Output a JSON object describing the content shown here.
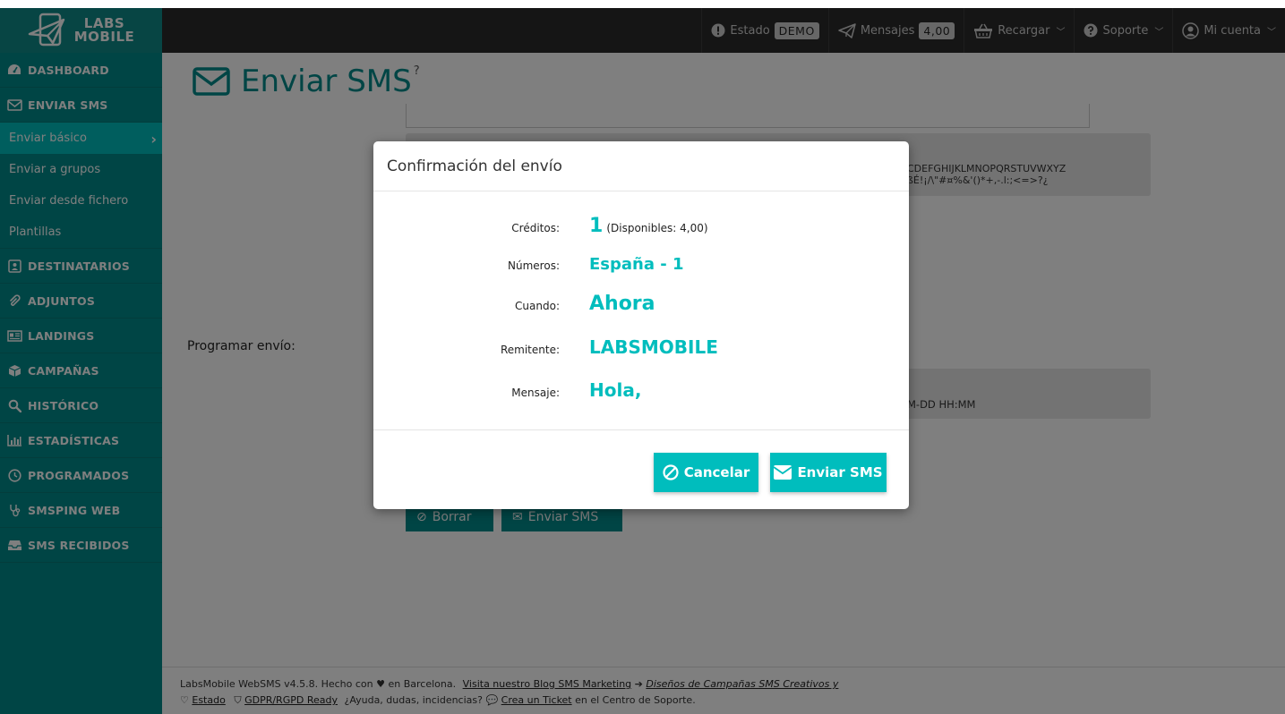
{
  "logo": {
    "line1": "LABS",
    "line2": "MOBILE"
  },
  "sidebar": {
    "items": [
      {
        "label": "DASHBOARD",
        "icon": "dashboard-icon"
      },
      {
        "label": "ENVIAR SMS",
        "icon": "envelope-icon"
      },
      {
        "label": "DESTINATARIOS",
        "icon": "contact-card-icon"
      },
      {
        "label": "ADJUNTOS",
        "icon": "paperclip-icon"
      },
      {
        "label": "LANDINGS",
        "icon": "landing-page-icon"
      },
      {
        "label": "CAMPAÑAS",
        "icon": "box-icon"
      },
      {
        "label": "HISTÓRICO",
        "icon": "search-icon"
      },
      {
        "label": "ESTADÍSTICAS",
        "icon": "bar-chart-icon"
      },
      {
        "label": "PROGRAMADOS",
        "icon": "clock-icon"
      },
      {
        "label": "SMSPING WEB",
        "icon": "stethoscope-icon"
      },
      {
        "label": "SMS RECIBIDOS",
        "icon": "inbox-icon"
      }
    ],
    "subitems": [
      {
        "label": "Enviar básico",
        "active": true
      },
      {
        "label": "Enviar a grupos"
      },
      {
        "label": "Enviar desde fichero"
      },
      {
        "label": "Plantillas"
      }
    ]
  },
  "topbar": {
    "estado_label": "Estado",
    "estado_badge": "DEMO",
    "mensajes_label": "Mensajes",
    "mensajes_badge": "4,00",
    "recargar_label": "Recargar",
    "soporte_label": "Soporte",
    "cuenta_label": "Mi cuenta"
  },
  "page": {
    "title": "Enviar SMS",
    "help": "?",
    "box_text_1": "CDEFGHIJKLMNOPQRSTUVWXYZ",
    "box_text_2": "ßÉ!¡/\\\"#¤%&'()*+,-.l:;<=>?¿",
    "date_hint": "M-DD HH:MM",
    "prog_label": "Programar envío:",
    "borrar_label": "Borrar",
    "enviar_label": "Enviar SMS"
  },
  "modal": {
    "title": "Confirmación del envío",
    "rows": {
      "creditos_label": "Créditos:",
      "creditos_value": "1",
      "creditos_note": "(Disponibles: 4,00)",
      "numeros_label": "Números:",
      "numeros_value": "España - 1",
      "cuando_label": "Cuando:",
      "cuando_value": "Ahora",
      "remitente_label": "Remitente:",
      "remitente_value": "LABSMOBILE",
      "mensaje_label": "Mensaje:",
      "mensaje_value": "Hola,"
    },
    "cancel_label": "Cancelar",
    "send_label": "Enviar SMS"
  },
  "footer": {
    "line1_a": "LabsMobile WebSMS v4.5.8. Hecho con",
    "line1_b": "en Barcelona.",
    "blog_link": "Visita nuestro Blog SMS Marketing",
    "campaigns_link": "Diseños de Campañas SMS Creativos y",
    "estado_link": "Estado",
    "gdpr_link": "GDPR/RGPD Ready",
    "help_text": "¿Ayuda, dudas, incidencias?",
    "ticket_link": "Crea un Ticket",
    "support_text": "en el Centro de Soporte."
  },
  "colors": {
    "sidebar": "#008b8b",
    "accent": "#00bdbd",
    "topbar": "#2b2b2b"
  }
}
